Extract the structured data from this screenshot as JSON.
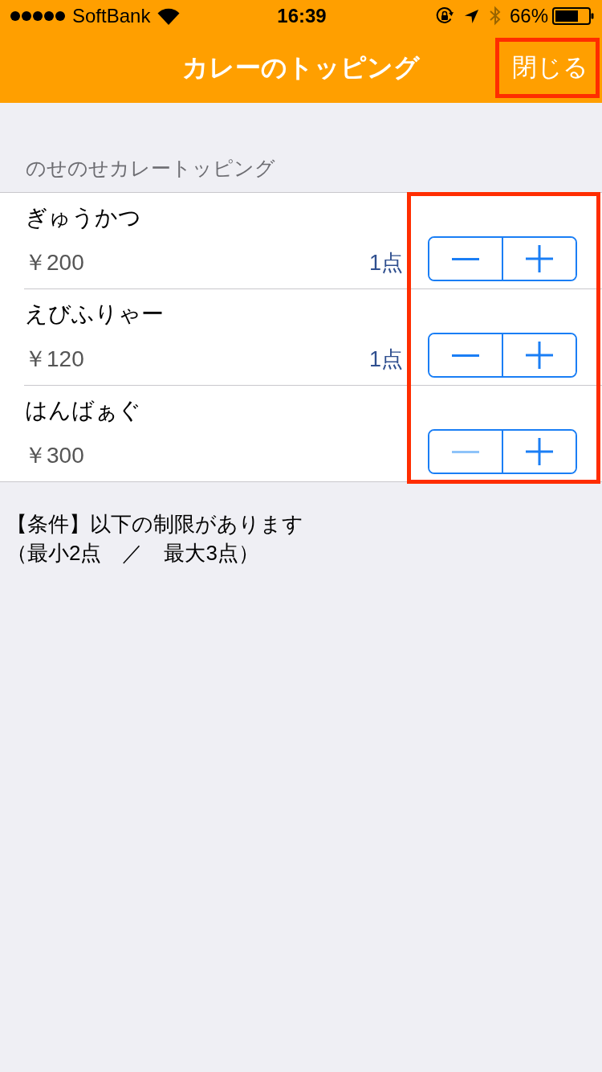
{
  "status_bar": {
    "carrier": "SoftBank",
    "time": "16:39",
    "battery": "66%"
  },
  "nav_bar": {
    "title": "カレーのトッピング",
    "close_button": {
      "label": "閉じる",
      "highlighted": true
    }
  },
  "section": {
    "header": "のせのせカレートッピング",
    "steppers_highlighted": true,
    "items": [
      {
        "name": "ぎゅうかつ",
        "price": "￥200",
        "count": "1点",
        "minus_disabled": false
      },
      {
        "name": "えびふりゃー",
        "price": "￥120",
        "count": "1点",
        "minus_disabled": false
      },
      {
        "name": "はんばぁぐ",
        "price": "￥300",
        "minus_disabled": true
      }
    ]
  },
  "conditions": [
    "【条件】以下の制限があります",
    "（最小2点　／　最大3点）"
  ]
}
